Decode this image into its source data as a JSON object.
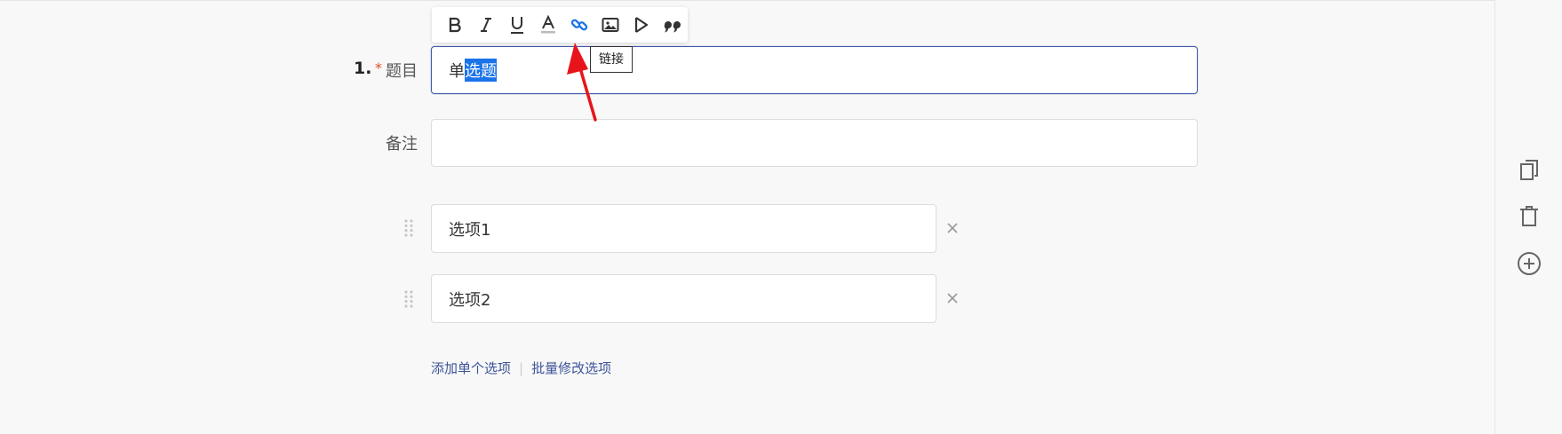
{
  "toolbar": {
    "buttons": [
      {
        "name": "bold",
        "icon": "bold-icon"
      },
      {
        "name": "italic",
        "icon": "italic-icon"
      },
      {
        "name": "underline",
        "icon": "underline-icon"
      },
      {
        "name": "font-color",
        "icon": "font-color-icon"
      },
      {
        "name": "link",
        "icon": "link-icon",
        "active": true
      },
      {
        "name": "image",
        "icon": "image-icon"
      },
      {
        "name": "video",
        "icon": "video-icon"
      },
      {
        "name": "quote",
        "icon": "quote-icon"
      }
    ],
    "tooltip": "链接"
  },
  "question": {
    "number": "1.",
    "required_mark": "*",
    "label": "题目",
    "title_prefix": "单",
    "title_selected": "选题",
    "note_label": "备注",
    "note_value": ""
  },
  "options": [
    {
      "value": "选项1"
    },
    {
      "value": "选项2"
    }
  ],
  "footer": {
    "add_single": "添加单个选项",
    "separator": "|",
    "batch_edit": "批量修改选项"
  },
  "side_actions": [
    {
      "icon": "copy-icon"
    },
    {
      "icon": "trash-icon"
    },
    {
      "icon": "plus-circle-icon"
    }
  ],
  "colors": {
    "accent": "#3f5ba9",
    "link_active": "#1a73e8",
    "required": "#e24a1f",
    "annotation_arrow": "#e8141b"
  }
}
